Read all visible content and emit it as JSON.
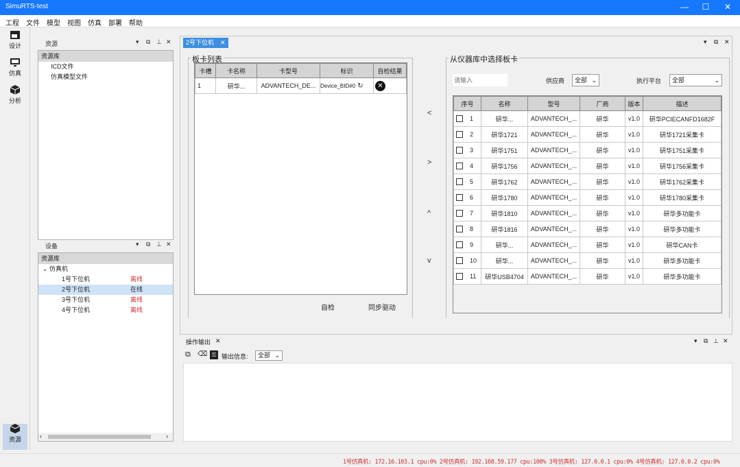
{
  "titlebar": {
    "title": "SimuRTS-test",
    "min": "—",
    "max": "☐",
    "close": "✕"
  },
  "menu": [
    "工程",
    "文件",
    "模型",
    "视图",
    "仿真",
    "部署",
    "帮助"
  ],
  "leftbar": {
    "design": "设计",
    "sim": "仿真",
    "analysis": "分析",
    "resource": "资源"
  },
  "resources_panel": {
    "title": "资源",
    "tree_header": "资源库",
    "items": [
      "ICD文件",
      "仿真模型文件"
    ]
  },
  "device_panel": {
    "title": "设备",
    "tree_header": "资源库",
    "root": "仿真机",
    "items": [
      {
        "name": "1号下位机",
        "status": "离线",
        "state": "off"
      },
      {
        "name": "2号下位机",
        "status": "在线",
        "state": "on"
      },
      {
        "name": "3号下位机",
        "status": "离线",
        "state": "off"
      },
      {
        "name": "4号下位机",
        "status": "离线",
        "state": "off"
      }
    ]
  },
  "doc_tab": {
    "label": "2号下位机"
  },
  "card_list": {
    "title": "板卡列表",
    "headers": [
      "卡槽",
      "卡名称",
      "卡型号",
      "标识",
      "自检结果"
    ],
    "rows": [
      {
        "slot": "1",
        "name": "研华...",
        "model": "ADVANTECH_DE...",
        "id": "Device_BID#0"
      }
    ],
    "selfcheck": "自检",
    "sync": "同步驱动"
  },
  "arrows": {
    "left": "<",
    "right": ">",
    "up": "^",
    "down": "v"
  },
  "library": {
    "title": "从仪器库中选择板卡",
    "search_placeholder": "请输入",
    "vendor_label": "供应商",
    "vendor_value": "全部",
    "platform_label": "执行平台",
    "platform_value": "全部",
    "headers": [
      "序号",
      "名称",
      "型号",
      "厂商",
      "版本",
      "描述"
    ],
    "rows": [
      {
        "no": "1",
        "name": "研华...",
        "model": "ADVANTECH_...",
        "vendor": "研华",
        "ver": "v1.0",
        "desc": "研华PCIECANFD1682F"
      },
      {
        "no": "2",
        "name": "研华1721",
        "model": "ADVANTECH_...",
        "vendor": "研华",
        "ver": "v1.0",
        "desc": "研华1721采集卡"
      },
      {
        "no": "3",
        "name": "研华1751",
        "model": "ADVANTECH_...",
        "vendor": "研华",
        "ver": "v1.0",
        "desc": "研华1751采集卡"
      },
      {
        "no": "4",
        "name": "研华1756",
        "model": "ADVANTECH_...",
        "vendor": "研华",
        "ver": "v1.0",
        "desc": "研华1756采集卡"
      },
      {
        "no": "5",
        "name": "研华1762",
        "model": "ADVANTECH_...",
        "vendor": "研华",
        "ver": "v1.0",
        "desc": "研华1762采集卡"
      },
      {
        "no": "6",
        "name": "研华1780",
        "model": "ADVANTECH_...",
        "vendor": "研华",
        "ver": "v1.0",
        "desc": "研华1780采集卡"
      },
      {
        "no": "7",
        "name": "研华1810",
        "model": "ADVANTECH_...",
        "vendor": "研华",
        "ver": "v1.0",
        "desc": "研华多功能卡"
      },
      {
        "no": "8",
        "name": "研华1816",
        "model": "ADVANTECH_...",
        "vendor": "研华",
        "ver": "v1.0",
        "desc": "研华多功能卡"
      },
      {
        "no": "9",
        "name": "研华...",
        "model": "ADVANTECH_...",
        "vendor": "研华",
        "ver": "v1.0",
        "desc": "研华CAN卡"
      },
      {
        "no": "10",
        "name": "研华...",
        "model": "ADVANTECH_...",
        "vendor": "研华",
        "ver": "v1.0",
        "desc": "研华多功能卡"
      },
      {
        "no": "11",
        "name": "研华USB4704",
        "model": "ADVANTECH_...",
        "vendor": "研华",
        "ver": "v1.0",
        "desc": "研华多功能卡"
      }
    ]
  },
  "output": {
    "title": "操作输出",
    "filter_label": "输出信息:",
    "filter_value": "全部"
  },
  "status": {
    "text": "1号仿真机: 172.16.103.1 cpu:0% 2号仿真机: 192.168.59.177 cpu:100% 3号仿真机: 127.0.0.1 cpu:0% 4号仿真机: 127.0.0.2 cpu:0%"
  },
  "colors": {
    "titlebar": "#1677ff",
    "offline": "#d03030",
    "selected": "#cfe3f7"
  }
}
